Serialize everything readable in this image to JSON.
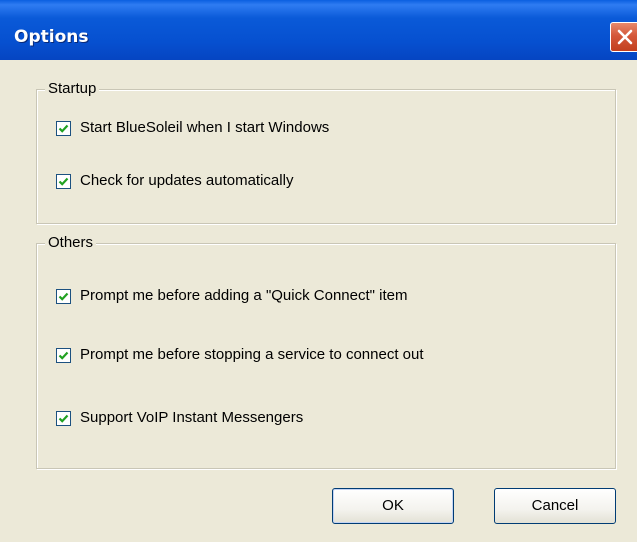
{
  "window": {
    "title": "Options",
    "close_icon": "close-icon"
  },
  "startup": {
    "label": "Startup",
    "items": [
      {
        "label": "Start BlueSoleil when I start Windows",
        "checked": true
      },
      {
        "label": "Check for updates automatically",
        "checked": true
      }
    ]
  },
  "others": {
    "label": "Others",
    "items": [
      {
        "label": "Prompt me before adding a \"Quick Connect\" item",
        "checked": true
      },
      {
        "label": "Prompt me before stopping a service to connect out",
        "checked": true
      },
      {
        "label": "Support VoIP Instant Messengers",
        "checked": true
      }
    ]
  },
  "buttons": {
    "ok": "OK",
    "cancel": "Cancel"
  },
  "colors": {
    "title_bar": "#0a5ad8",
    "dialog_bg": "#ece9d8",
    "close_button": "#d4583a"
  }
}
